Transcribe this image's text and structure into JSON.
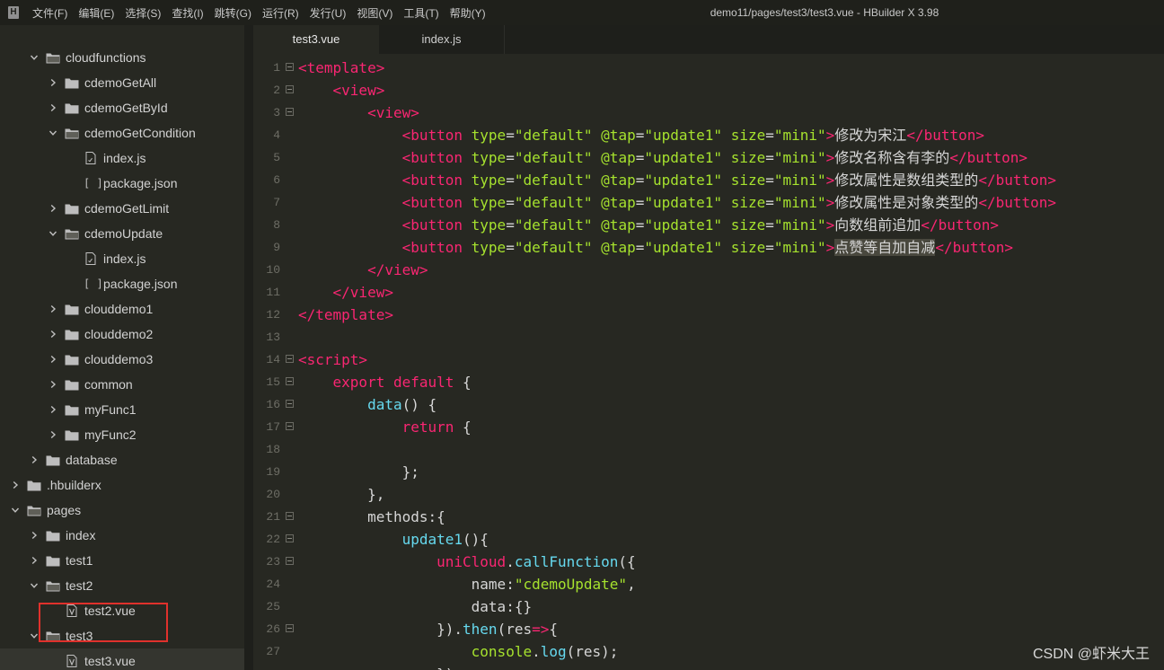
{
  "menubar": {
    "app_icon": "hbuilder-logo-icon",
    "items": [
      "文件(F)",
      "编辑(E)",
      "选择(S)",
      "查找(I)",
      "跳转(G)",
      "运行(R)",
      "发行(U)",
      "视图(V)",
      "工具(T)",
      "帮助(Y)"
    ],
    "window_title": "demo11/pages/test3/test3.vue - HBuilder X 3.98"
  },
  "sidebar": {
    "rows": [
      {
        "label": "cloudfunctions",
        "type": "folder",
        "state": "expanded",
        "depth": 2
      },
      {
        "label": "cdemoGetAll",
        "type": "folder",
        "state": "collapsed",
        "depth": 3
      },
      {
        "label": "cdemoGetById",
        "type": "folder",
        "state": "collapsed",
        "depth": 3
      },
      {
        "label": "cdemoGetCondition",
        "type": "folder",
        "state": "expanded",
        "depth": 3
      },
      {
        "label": "index.js",
        "type": "file-js",
        "state": "none",
        "depth": 4
      },
      {
        "label": "package.json",
        "type": "file-json",
        "state": "none",
        "depth": 4
      },
      {
        "label": "cdemoGetLimit",
        "type": "folder",
        "state": "collapsed",
        "depth": 3
      },
      {
        "label": "cdemoUpdate",
        "type": "folder",
        "state": "expanded",
        "depth": 3
      },
      {
        "label": "index.js",
        "type": "file-js",
        "state": "none",
        "depth": 4
      },
      {
        "label": "package.json",
        "type": "file-json",
        "state": "none",
        "depth": 4
      },
      {
        "label": "clouddemo1",
        "type": "folder",
        "state": "collapsed",
        "depth": 3
      },
      {
        "label": "clouddemo2",
        "type": "folder",
        "state": "collapsed",
        "depth": 3
      },
      {
        "label": "clouddemo3",
        "type": "folder",
        "state": "collapsed",
        "depth": 3
      },
      {
        "label": "common",
        "type": "folder",
        "state": "collapsed",
        "depth": 3
      },
      {
        "label": "myFunc1",
        "type": "folder",
        "state": "collapsed",
        "depth": 3
      },
      {
        "label": "myFunc2",
        "type": "folder",
        "state": "collapsed",
        "depth": 3
      },
      {
        "label": "database",
        "type": "folder",
        "state": "collapsed",
        "depth": 2
      },
      {
        "label": ".hbuilderx",
        "type": "folder",
        "state": "collapsed",
        "depth": 1
      },
      {
        "label": "pages",
        "type": "folder",
        "state": "expanded",
        "depth": 1
      },
      {
        "label": "index",
        "type": "folder",
        "state": "collapsed",
        "depth": 2
      },
      {
        "label": "test1",
        "type": "folder",
        "state": "collapsed",
        "depth": 2
      },
      {
        "label": "test2",
        "type": "folder",
        "state": "expanded",
        "depth": 2
      },
      {
        "label": "test2.vue",
        "type": "file-vue",
        "state": "none",
        "depth": 3
      },
      {
        "label": "test3",
        "type": "folder",
        "state": "expanded",
        "depth": 2
      },
      {
        "label": "test3.vue",
        "type": "file-vue",
        "state": "none",
        "depth": 3,
        "selected": true
      }
    ]
  },
  "tabs": [
    {
      "label": "test3.vue",
      "active": true
    },
    {
      "label": "index.js",
      "active": false
    }
  ],
  "editor": {
    "lines": [
      {
        "n": "1",
        "fold": true,
        "tokens": [
          [
            "tag",
            "<template>"
          ]
        ]
      },
      {
        "n": "2",
        "fold": true,
        "tokens": [
          [
            "def",
            "    "
          ],
          [
            "tag",
            "<view>"
          ]
        ]
      },
      {
        "n": "3",
        "fold": true,
        "tokens": [
          [
            "def",
            "        "
          ],
          [
            "tag",
            "<view>"
          ]
        ]
      },
      {
        "n": "4",
        "fold": false,
        "tokens": [
          [
            "def",
            "            "
          ],
          [
            "tag",
            "<button "
          ],
          [
            "attr",
            "type"
          ],
          [
            "punc",
            "="
          ],
          [
            "str",
            "\"default\""
          ],
          [
            "def",
            " "
          ],
          [
            "attr",
            "@tap"
          ],
          [
            "punc",
            "="
          ],
          [
            "str",
            "\"update1\""
          ],
          [
            "def",
            " "
          ],
          [
            "attr",
            "size"
          ],
          [
            "punc",
            "="
          ],
          [
            "str",
            "\"mini\""
          ],
          [
            "tag",
            ">"
          ],
          [
            "def",
            "修改为宋江"
          ],
          [
            "tag",
            "</button>"
          ]
        ]
      },
      {
        "n": "5",
        "fold": false,
        "tokens": [
          [
            "def",
            "            "
          ],
          [
            "tag",
            "<button "
          ],
          [
            "attr",
            "type"
          ],
          [
            "punc",
            "="
          ],
          [
            "str",
            "\"default\""
          ],
          [
            "def",
            " "
          ],
          [
            "attr",
            "@tap"
          ],
          [
            "punc",
            "="
          ],
          [
            "str",
            "\"update1\""
          ],
          [
            "def",
            " "
          ],
          [
            "attr",
            "size"
          ],
          [
            "punc",
            "="
          ],
          [
            "str",
            "\"mini\""
          ],
          [
            "tag",
            ">"
          ],
          [
            "def",
            "修改名称含有李的"
          ],
          [
            "tag",
            "</button>"
          ]
        ]
      },
      {
        "n": "6",
        "fold": false,
        "tokens": [
          [
            "def",
            "            "
          ],
          [
            "tag",
            "<button "
          ],
          [
            "attr",
            "type"
          ],
          [
            "punc",
            "="
          ],
          [
            "str",
            "\"default\""
          ],
          [
            "def",
            " "
          ],
          [
            "attr",
            "@tap"
          ],
          [
            "punc",
            "="
          ],
          [
            "str",
            "\"update1\""
          ],
          [
            "def",
            " "
          ],
          [
            "attr",
            "size"
          ],
          [
            "punc",
            "="
          ],
          [
            "str",
            "\"mini\""
          ],
          [
            "tag",
            ">"
          ],
          [
            "def",
            "修改属性是数组类型的"
          ],
          [
            "tag",
            "</button>"
          ]
        ]
      },
      {
        "n": "7",
        "fold": false,
        "tokens": [
          [
            "def",
            "            "
          ],
          [
            "tag",
            "<button "
          ],
          [
            "attr",
            "type"
          ],
          [
            "punc",
            "="
          ],
          [
            "str",
            "\"default\""
          ],
          [
            "def",
            " "
          ],
          [
            "attr",
            "@tap"
          ],
          [
            "punc",
            "="
          ],
          [
            "str",
            "\"update1\""
          ],
          [
            "def",
            " "
          ],
          [
            "attr",
            "size"
          ],
          [
            "punc",
            "="
          ],
          [
            "str",
            "\"mini\""
          ],
          [
            "tag",
            ">"
          ],
          [
            "def",
            "修改属性是对象类型的"
          ],
          [
            "tag",
            "</button>"
          ]
        ]
      },
      {
        "n": "8",
        "fold": false,
        "tokens": [
          [
            "def",
            "            "
          ],
          [
            "tag",
            "<button "
          ],
          [
            "attr",
            "type"
          ],
          [
            "punc",
            "="
          ],
          [
            "str",
            "\"default\""
          ],
          [
            "def",
            " "
          ],
          [
            "attr",
            "@tap"
          ],
          [
            "punc",
            "="
          ],
          [
            "str",
            "\"update1\""
          ],
          [
            "def",
            " "
          ],
          [
            "attr",
            "size"
          ],
          [
            "punc",
            "="
          ],
          [
            "str",
            "\"mini\""
          ],
          [
            "tag",
            ">"
          ],
          [
            "def",
            "向数组前追加"
          ],
          [
            "tag",
            "</button>"
          ]
        ]
      },
      {
        "n": "9",
        "fold": false,
        "tokens": [
          [
            "def",
            "            "
          ],
          [
            "tag",
            "<button "
          ],
          [
            "attr",
            "type"
          ],
          [
            "punc",
            "="
          ],
          [
            "str",
            "\"default\""
          ],
          [
            "def",
            " "
          ],
          [
            "attr",
            "@tap"
          ],
          [
            "punc",
            "="
          ],
          [
            "str",
            "\"update1\""
          ],
          [
            "def",
            " "
          ],
          [
            "attr",
            "size"
          ],
          [
            "punc",
            "="
          ],
          [
            "str",
            "\"mini\""
          ],
          [
            "tag",
            ">"
          ],
          [
            "sel",
            "点赞等自加自减"
          ],
          [
            "tag",
            "</button>"
          ]
        ]
      },
      {
        "n": "10",
        "fold": false,
        "tokens": [
          [
            "def",
            "        "
          ],
          [
            "tag",
            "</view>"
          ]
        ]
      },
      {
        "n": "11",
        "fold": false,
        "tokens": [
          [
            "def",
            "    "
          ],
          [
            "tag",
            "</view>"
          ]
        ]
      },
      {
        "n": "12",
        "fold": false,
        "tokens": [
          [
            "tag",
            "</template>"
          ]
        ]
      },
      {
        "n": "13",
        "fold": false,
        "tokens": []
      },
      {
        "n": "14",
        "fold": true,
        "tokens": [
          [
            "tag",
            "<script>"
          ]
        ]
      },
      {
        "n": "15",
        "fold": true,
        "tokens": [
          [
            "def",
            "    "
          ],
          [
            "kw",
            "export"
          ],
          [
            "def",
            " "
          ],
          [
            "kw",
            "default"
          ],
          [
            "def",
            " {"
          ]
        ]
      },
      {
        "n": "16",
        "fold": true,
        "tokens": [
          [
            "def",
            "        "
          ],
          [
            "fn",
            "data"
          ],
          [
            "def",
            "() {"
          ]
        ]
      },
      {
        "n": "17",
        "fold": true,
        "tokens": [
          [
            "def",
            "            "
          ],
          [
            "kw",
            "return"
          ],
          [
            "def",
            " {"
          ]
        ]
      },
      {
        "n": "18",
        "fold": false,
        "tokens": []
      },
      {
        "n": "19",
        "fold": false,
        "tokens": [
          [
            "def",
            "            };"
          ]
        ]
      },
      {
        "n": "20",
        "fold": false,
        "tokens": [
          [
            "def",
            "        },"
          ]
        ]
      },
      {
        "n": "21",
        "fold": true,
        "tokens": [
          [
            "def",
            "        methods:{"
          ]
        ]
      },
      {
        "n": "22",
        "fold": true,
        "tokens": [
          [
            "def",
            "            "
          ],
          [
            "fn",
            "update1"
          ],
          [
            "def",
            "(){"
          ]
        ]
      },
      {
        "n": "23",
        "fold": true,
        "tokens": [
          [
            "def",
            "                "
          ],
          [
            "kw",
            "uniCloud"
          ],
          [
            "def",
            "."
          ],
          [
            "fn",
            "callFunction"
          ],
          [
            "def",
            "({"
          ]
        ]
      },
      {
        "n": "24",
        "fold": false,
        "tokens": [
          [
            "def",
            "                    name:"
          ],
          [
            "str",
            "\"cdemoUpdate\""
          ],
          [
            "def",
            ","
          ]
        ]
      },
      {
        "n": "25",
        "fold": false,
        "tokens": [
          [
            "def",
            "                    data:{}"
          ]
        ]
      },
      {
        "n": "26",
        "fold": true,
        "tokens": [
          [
            "def",
            "                })."
          ],
          [
            "fn",
            "then"
          ],
          [
            "def",
            "(res"
          ],
          [
            "kw",
            "=>"
          ],
          [
            "def",
            "{"
          ]
        ]
      },
      {
        "n": "27",
        "fold": false,
        "tokens": [
          [
            "def",
            "                    "
          ],
          [
            "str",
            "console"
          ],
          [
            "def",
            "."
          ],
          [
            "fn",
            "log"
          ],
          [
            "def",
            "(res);"
          ]
        ]
      },
      {
        "n": "",
        "fold": false,
        "tokens": [
          [
            "def",
            "                })"
          ]
        ]
      }
    ]
  },
  "watermark": "CSDN @虾米大王"
}
